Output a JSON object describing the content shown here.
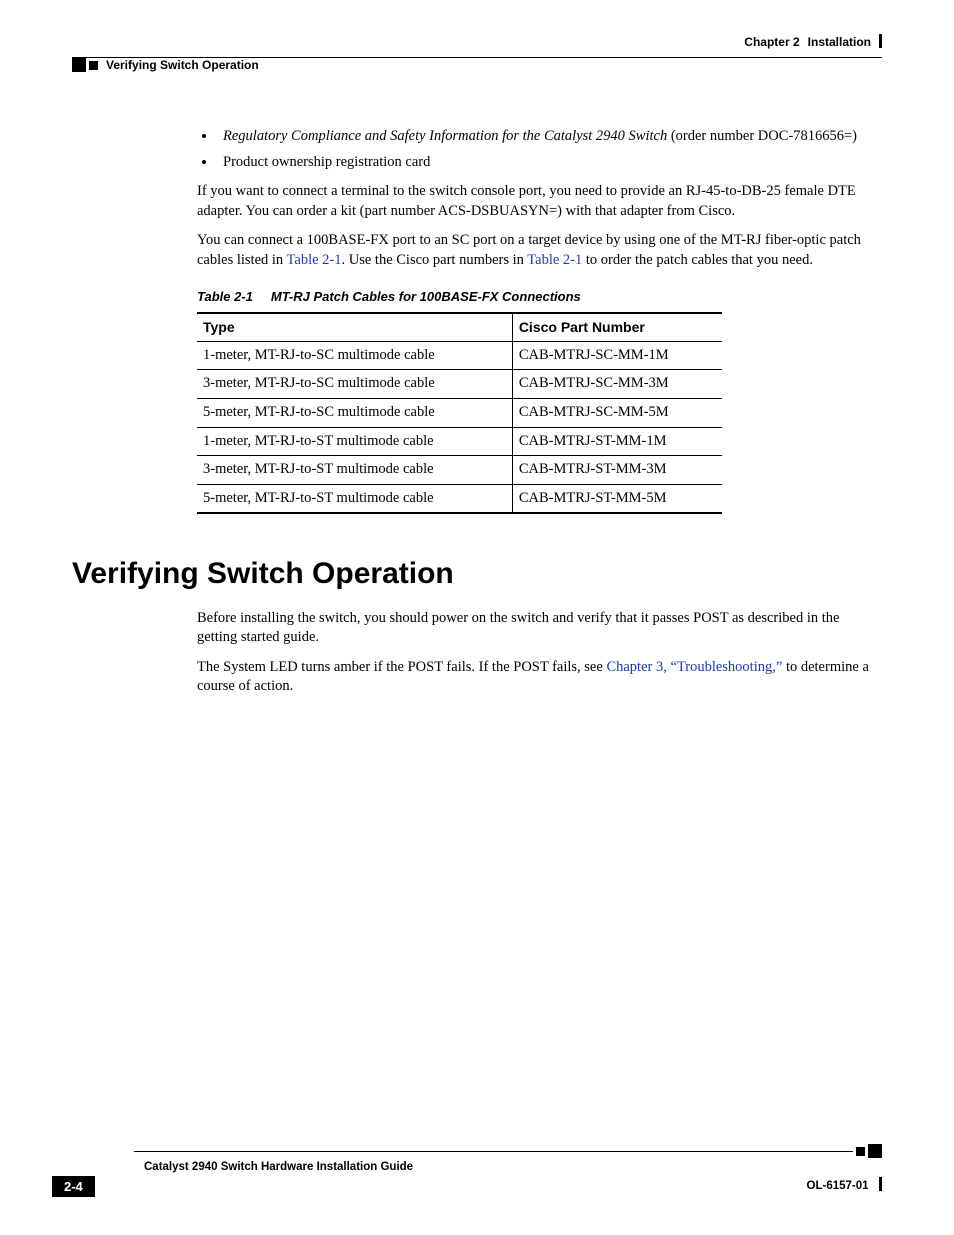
{
  "header": {
    "chapter_label": "Chapter 2",
    "chapter_title": "Installation",
    "section_running": "Verifying Switch Operation"
  },
  "bullets": [
    {
      "italic": "Regulatory Compliance and Safety Information for the Catalyst 2940 Switch",
      "plain": "(order number DOC-7816656=)"
    },
    {
      "italic": "",
      "plain": "Product ownership registration card"
    }
  ],
  "para1": "If you want to connect a terminal to the switch console port, you need to provide an RJ-45-to-DB-25 female DTE adapter. You can order a kit (part number ACS-DSBUASYN=) with that adapter from Cisco.",
  "para2_a": "You can connect a 100BASE-FX port to an SC port on a target device by using one of the MT-RJ fiber-optic patch cables listed in ",
  "para2_link1": "Table 2-1",
  "para2_b": ". Use the Cisco part numbers in ",
  "para2_link2": "Table 2-1",
  "para2_c": " to order the patch cables that you need.",
  "table": {
    "number": "Table 2-1",
    "title": "MT-RJ Patch Cables for 100BASE-FX Connections",
    "headers": [
      "Type",
      "Cisco Part Number"
    ],
    "rows": [
      [
        "1-meter, MT-RJ-to-SC multimode cable",
        "CAB-MTRJ-SC-MM-1M"
      ],
      [
        "3-meter, MT-RJ-to-SC multimode cable",
        "CAB-MTRJ-SC-MM-3M"
      ],
      [
        "5-meter, MT-RJ-to-SC multimode cable",
        "CAB-MTRJ-SC-MM-5M"
      ],
      [
        "1-meter, MT-RJ-to-ST multimode cable",
        "CAB-MTRJ-ST-MM-1M"
      ],
      [
        "3-meter, MT-RJ-to-ST multimode cable",
        "CAB-MTRJ-ST-MM-3M"
      ],
      [
        "5-meter, MT-RJ-to-ST multimode cable",
        "CAB-MTRJ-ST-MM-5M"
      ]
    ]
  },
  "section_heading": "Verifying Switch Operation",
  "para3": "Before installing the switch, you should power on the switch and verify that it passes POST as described in the getting started guide.",
  "para4_a": "The System LED turns amber if the POST fails. If the POST fails, see ",
  "para4_link": "Chapter 3, “Troubleshooting,”",
  "para4_b": " to determine a course of action.",
  "footer": {
    "book_title": "Catalyst 2940 Switch Hardware Installation Guide",
    "page_number": "2-4",
    "doc_number": "OL-6157-01"
  }
}
